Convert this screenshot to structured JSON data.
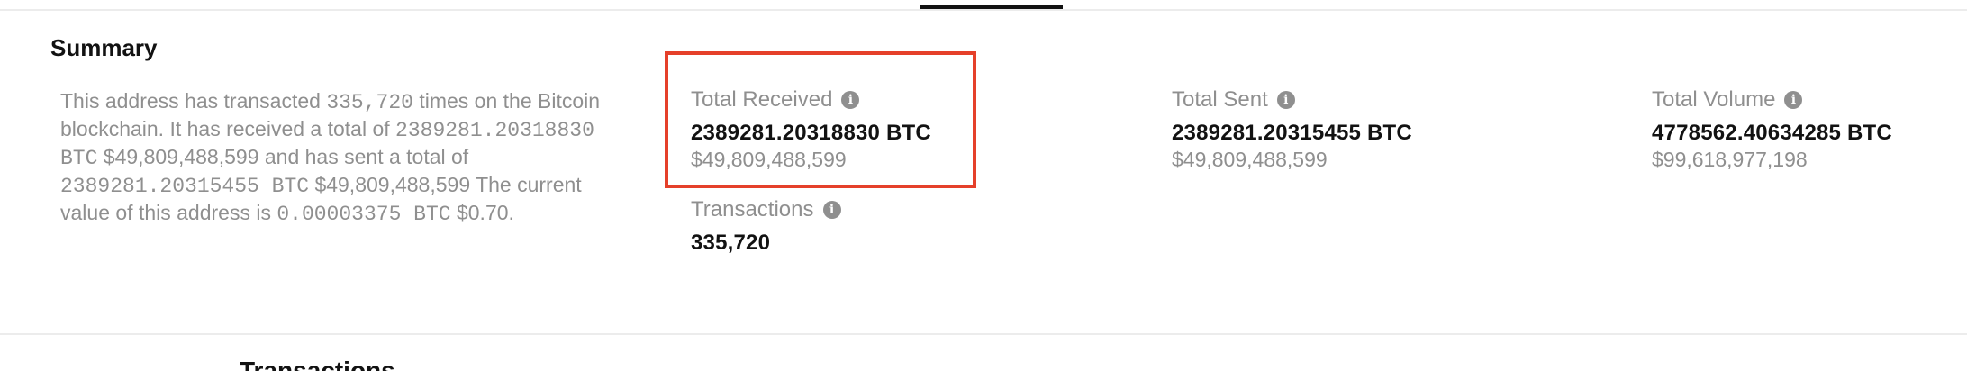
{
  "summary": {
    "title": "Summary",
    "description_parts": {
      "p1": "This address has transacted ",
      "tx_count": "335,720",
      "p2": " times on the Bitcoin blockchain. It has received a total of ",
      "received_btc": "2389281.20318830 BTC",
      "p3": " ",
      "received_usd": "$49,809,488,599",
      "p4": " and has sent a total of ",
      "sent_btc": "2389281.20315455 BTC",
      "p5": " ",
      "sent_usd": "$49,809,488,599",
      "p6": " The current value of this address is ",
      "balance_btc": "0.00003375 BTC",
      "p7": " ",
      "balance_usd": "$0.70",
      "p8": "."
    }
  },
  "stats": {
    "total_received": {
      "label": "Total Received",
      "value": "2389281.20318830 BTC",
      "usd": "$49,809,488,599"
    },
    "transactions": {
      "label": "Transactions",
      "value": "335,720"
    },
    "total_sent": {
      "label": "Total Sent",
      "value": "2389281.20315455 BTC",
      "usd": "$49,809,488,599"
    },
    "total_volume": {
      "label": "Total Volume",
      "value": "4778562.40634285 BTC",
      "usd": "$99,618,977,198"
    }
  },
  "info_icon_glyph": "i",
  "next_section": {
    "title": "Transactions"
  },
  "colors": {
    "highlight": "#e5402a",
    "muted_text": "#8f8f8f",
    "primary_text": "#121212"
  }
}
